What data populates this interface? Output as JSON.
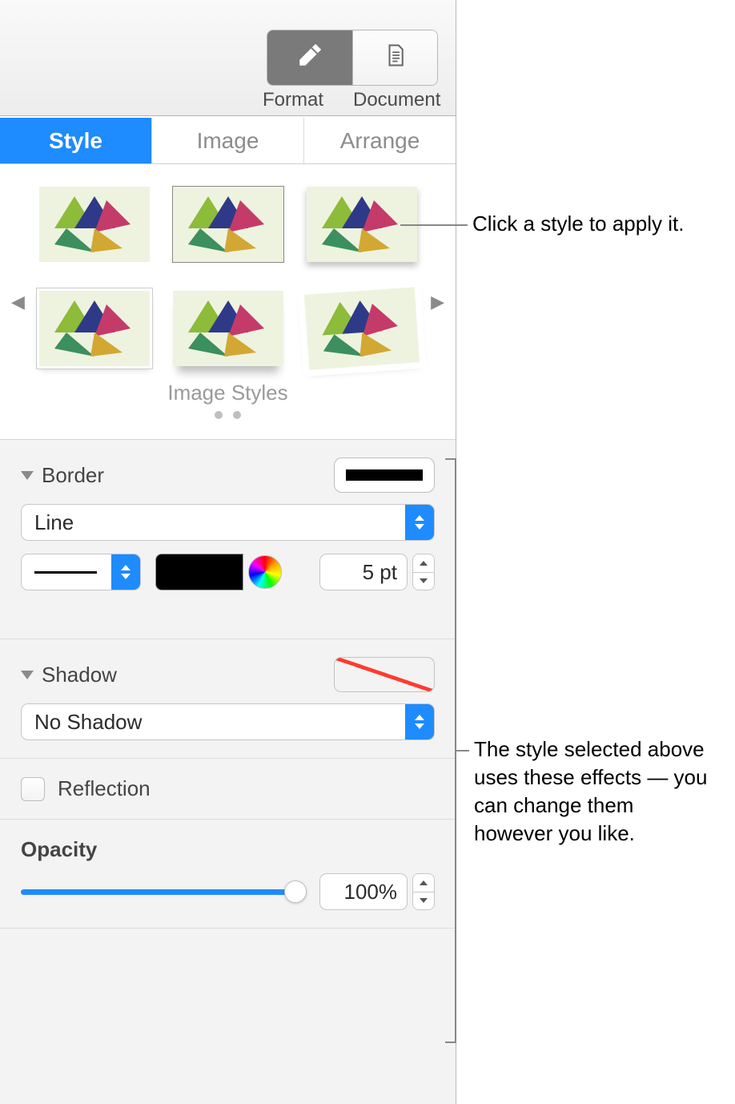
{
  "toolbar": {
    "format_label": "Format",
    "document_label": "Document"
  },
  "subtabs": {
    "style": "Style",
    "image": "Image",
    "arrange": "Arrange"
  },
  "styles": {
    "caption": "Image Styles"
  },
  "border": {
    "title": "Border",
    "type": "Line",
    "size": "5 pt"
  },
  "shadow": {
    "title": "Shadow",
    "type": "No Shadow"
  },
  "reflection": {
    "title": "Reflection"
  },
  "opacity": {
    "title": "Opacity",
    "value": "100%"
  },
  "annotations": {
    "style_click": "Click a style to apply it.",
    "effects": "The style selected above uses these effects — you can change them however you like."
  }
}
